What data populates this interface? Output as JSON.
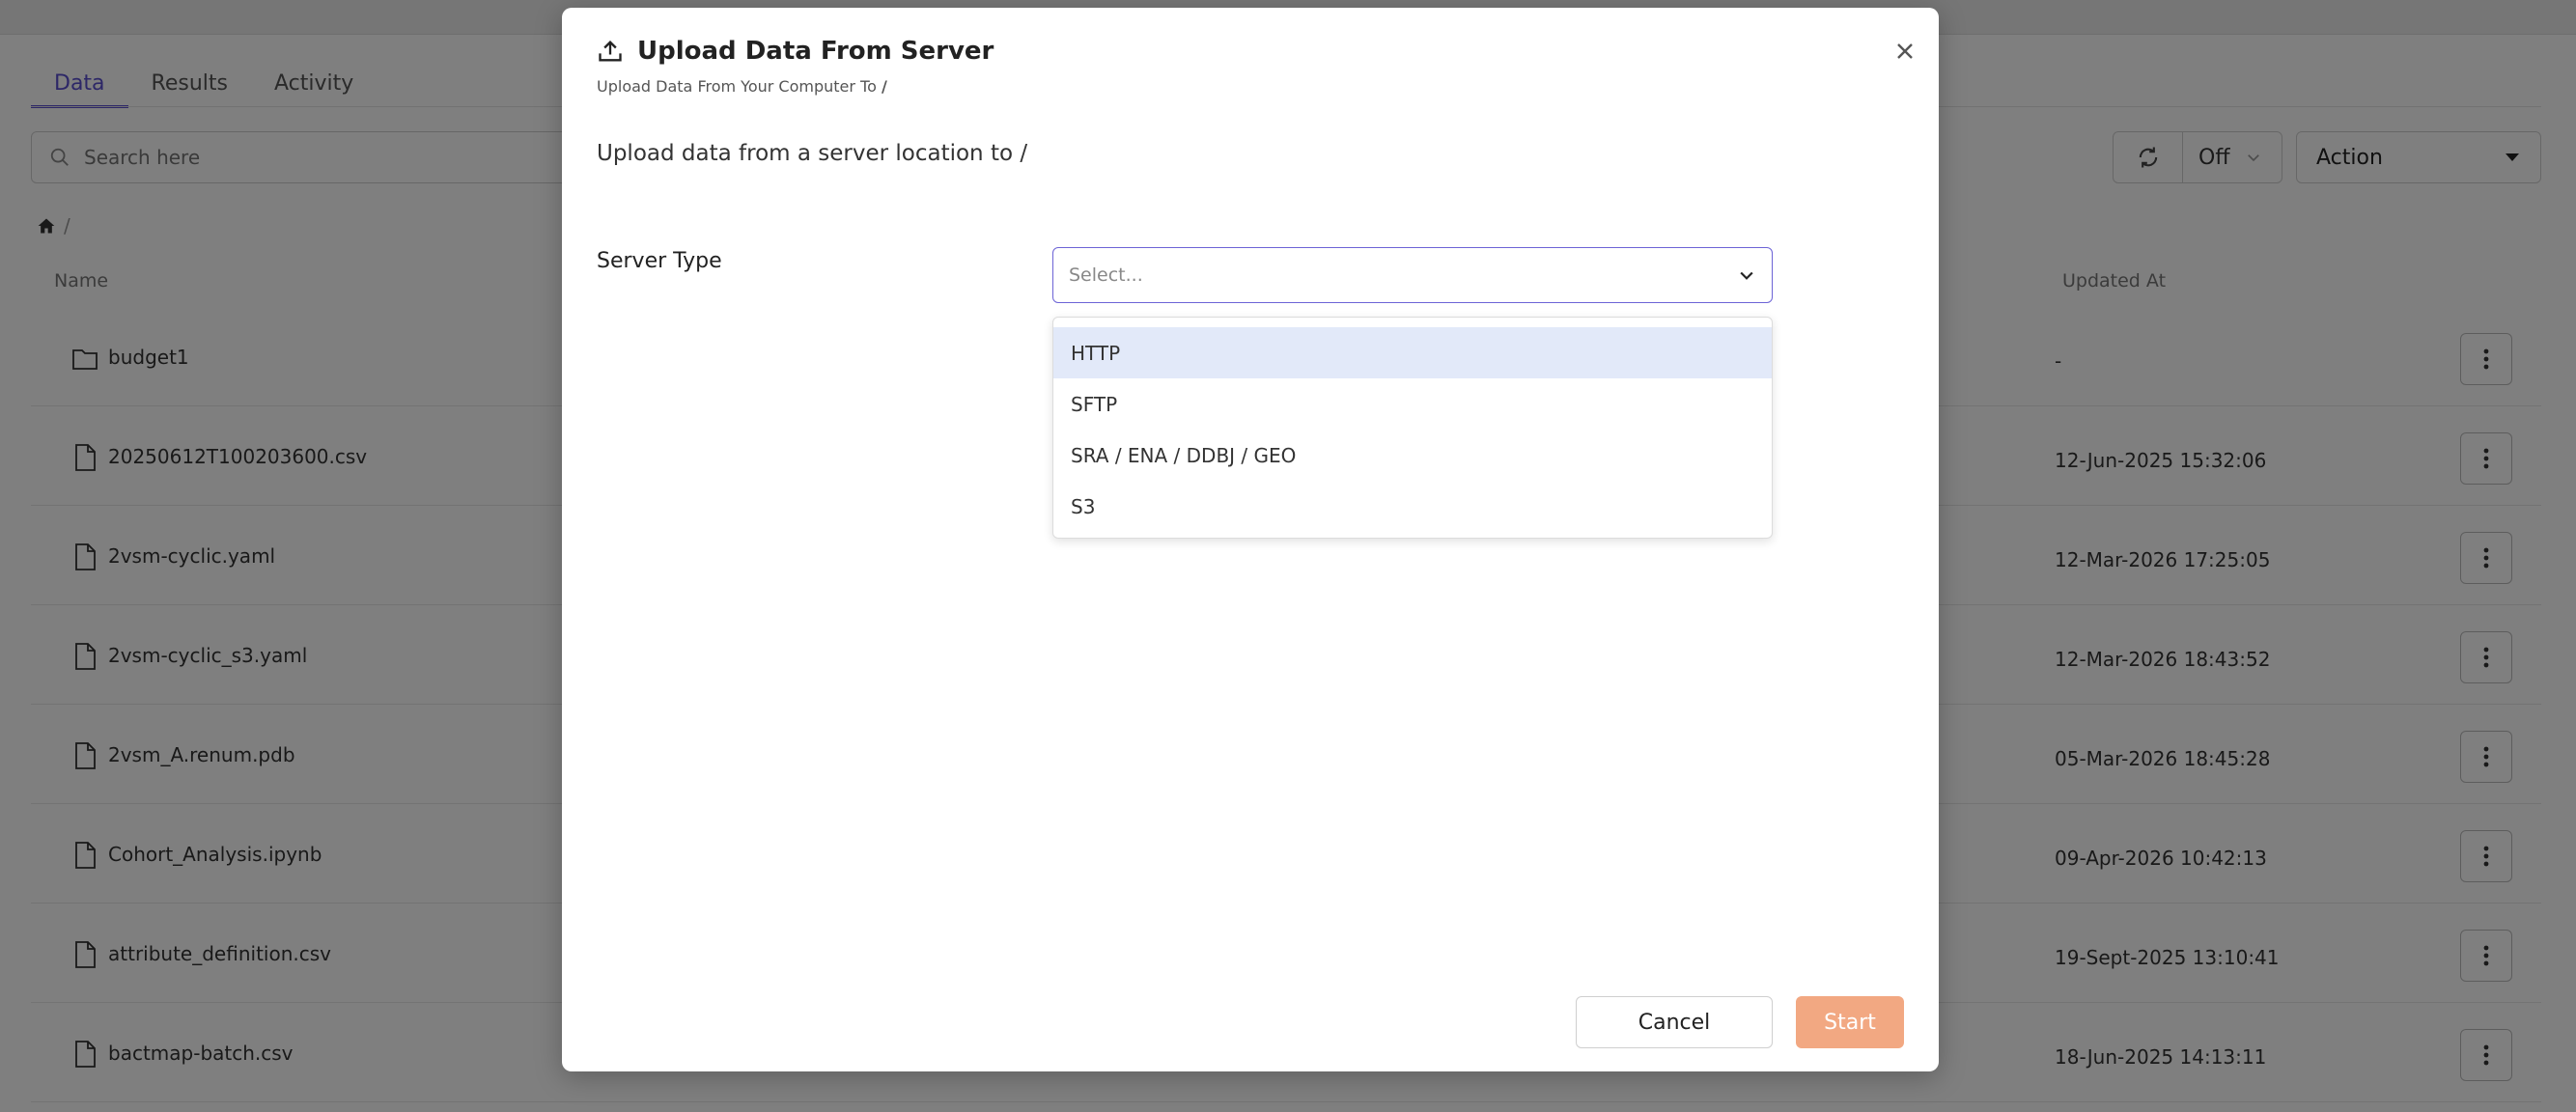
{
  "colors": {
    "accent": "#5a4fcf",
    "start_button": "#f2a882",
    "highlight": "#e2e9f9"
  },
  "page": {
    "tabs": [
      {
        "label": "Data",
        "active": true
      },
      {
        "label": "Results",
        "active": false
      },
      {
        "label": "Activity",
        "active": false
      }
    ],
    "search": {
      "placeholder": "Search here"
    },
    "refresh": {
      "value": "Off"
    },
    "action": {
      "label": "Action"
    },
    "breadcrumb": "/",
    "columns": {
      "name": "Name",
      "updated": "Updated At"
    },
    "files": [
      {
        "name": "budget1",
        "type": "folder",
        "updated": "-"
      },
      {
        "name": "20250612T100203600.csv",
        "type": "file",
        "updated": "12-Jun-2025 15:32:06"
      },
      {
        "name": "2vsm-cyclic.yaml",
        "type": "file",
        "updated": "12-Mar-2026 17:25:05"
      },
      {
        "name": "2vsm-cyclic_s3.yaml",
        "type": "file",
        "updated": "12-Mar-2026 18:43:52"
      },
      {
        "name": "2vsm_A.renum.pdb",
        "type": "file",
        "updated": "05-Mar-2026 18:45:28"
      },
      {
        "name": "Cohort_Analysis.ipynb",
        "type": "file",
        "updated": "09-Apr-2026 10:42:13"
      },
      {
        "name": "attribute_definition.csv",
        "type": "file",
        "updated": "19-Sept-2025 13:10:41"
      },
      {
        "name": "bactmap-batch.csv",
        "type": "file",
        "updated": "18-Jun-2025 14:13:11"
      }
    ]
  },
  "modal": {
    "title": "Upload Data From Server",
    "subtitle_prefix": "Upload Data From Your Computer To",
    "subtitle_path": "/",
    "intro": "Upload data from a server location to /",
    "server_type": {
      "label": "Server Type",
      "placeholder": "Select...",
      "options": [
        "HTTP",
        "SFTP",
        "SRA / ENA / DDBJ / GEO",
        "S3"
      ],
      "highlighted": "HTTP"
    },
    "cancel_label": "Cancel",
    "start_label": "Start"
  }
}
